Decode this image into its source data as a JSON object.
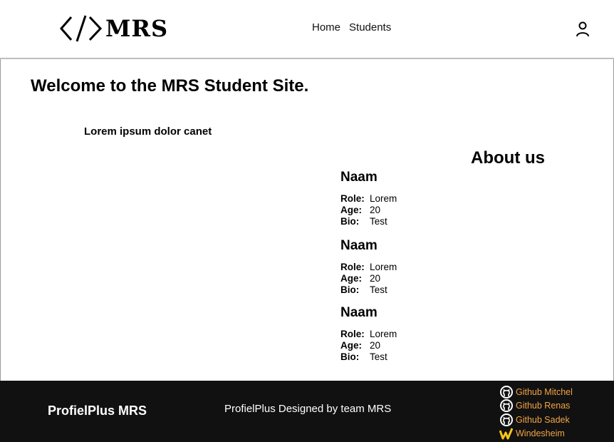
{
  "header": {
    "logo_text": "MRS",
    "nav": [
      {
        "label": "Home"
      },
      {
        "label": "Students"
      }
    ],
    "user_icon": "user-icon"
  },
  "main": {
    "title": "Welcome to the MRS Student Site.",
    "intro": "Lorem ipsum dolor canet",
    "about_title": "About us",
    "members": [
      {
        "name": "Naam",
        "role_label": "Role:",
        "role": "Lorem",
        "age_label": "Age:",
        "age": "20",
        "bio_label": "Bio:",
        "bio": "Test"
      },
      {
        "name": "Naam",
        "role_label": "Role:",
        "role": "Lorem",
        "age_label": "Age:",
        "age": "20",
        "bio_label": "Bio:",
        "bio": "Test"
      },
      {
        "name": "Naam",
        "role_label": "Role:",
        "role": "Lorem",
        "age_label": "Age:",
        "age": "20",
        "bio_label": "Bio:",
        "bio": "Test"
      }
    ]
  },
  "footer": {
    "brand": "ProfielPlus MRS",
    "tagline": "ProfielPlus Designed by team MRS",
    "links": [
      {
        "label": "Github Mitchel",
        "icon": "github-icon"
      },
      {
        "label": "Github Renas",
        "icon": "github-icon"
      },
      {
        "label": "Github Sadek",
        "icon": "github-icon"
      },
      {
        "label": "Windesheim",
        "icon": "windesheim-icon"
      }
    ],
    "link_color": "#f2a444",
    "background": "#111111"
  }
}
